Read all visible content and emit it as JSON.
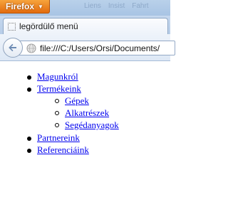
{
  "titlebar": {
    "app_button_label": "Firefox",
    "faded_menu": [
      "Liens",
      "Insist",
      "Fahrt"
    ]
  },
  "tab": {
    "title": "legördülő menü"
  },
  "navbar": {
    "url": "file:///C:/Users/Orsi/Documents/"
  },
  "menu": {
    "items": [
      {
        "label": "Magunkról"
      },
      {
        "label": "Termékeink",
        "children": [
          {
            "label": "Gépek"
          },
          {
            "label": "Alkatrészek"
          },
          {
            "label": "Segédanyagok"
          }
        ]
      },
      {
        "label": "Partnereink"
      },
      {
        "label": "Referenciáink"
      }
    ]
  },
  "colors": {
    "firefox_button": "#e8780f",
    "link": "#0000ee",
    "titlebar": "#b9d1ea"
  }
}
